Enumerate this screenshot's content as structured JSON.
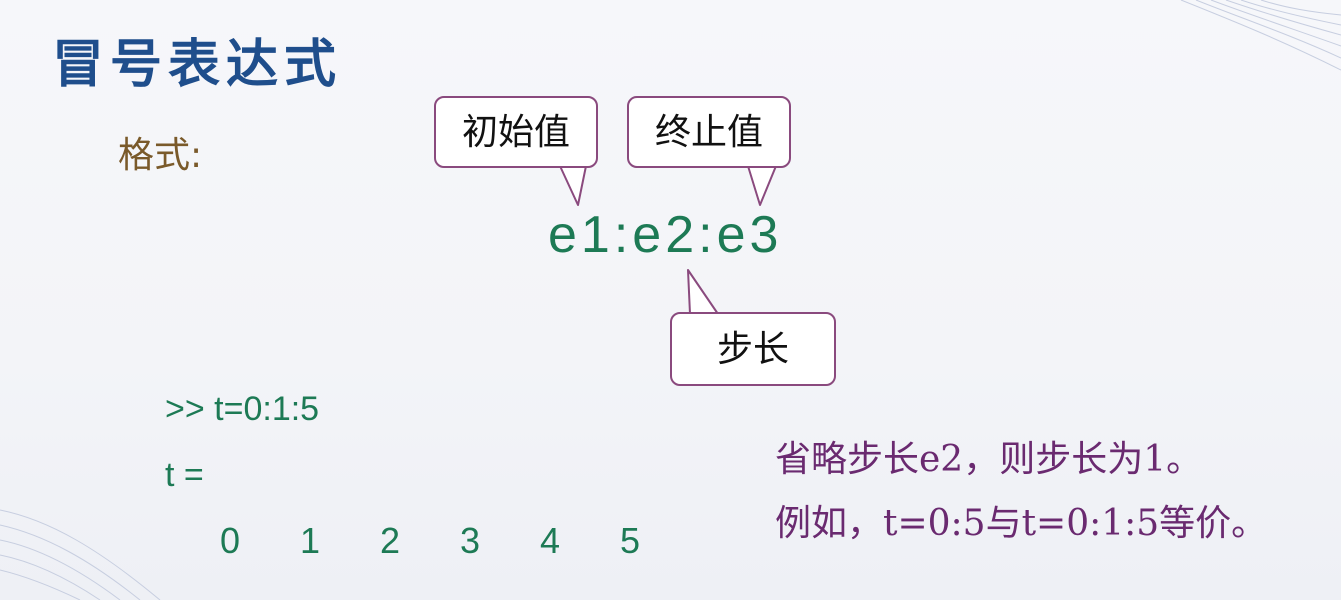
{
  "slide": {
    "title": "冒号表达式",
    "format_label": "格式:",
    "expression": "e1:e2:e3",
    "callouts": {
      "start": "初始值",
      "end": "终止值",
      "step": "步长"
    },
    "command": {
      "line": ">> t=0:1:5",
      "var": "t =",
      "values": [
        "0",
        "1",
        "2",
        "3",
        "4",
        "5"
      ]
    },
    "notes": [
      "省略步长e2，则步长为1。",
      "例如，t=0:5与t=0:1:5等价。"
    ]
  },
  "colors": {
    "title": "#1f4e8c",
    "label": "#7a5a2a",
    "code": "#1d7a55",
    "note": "#6a2a70",
    "callout_border": "#8a4a7e"
  }
}
